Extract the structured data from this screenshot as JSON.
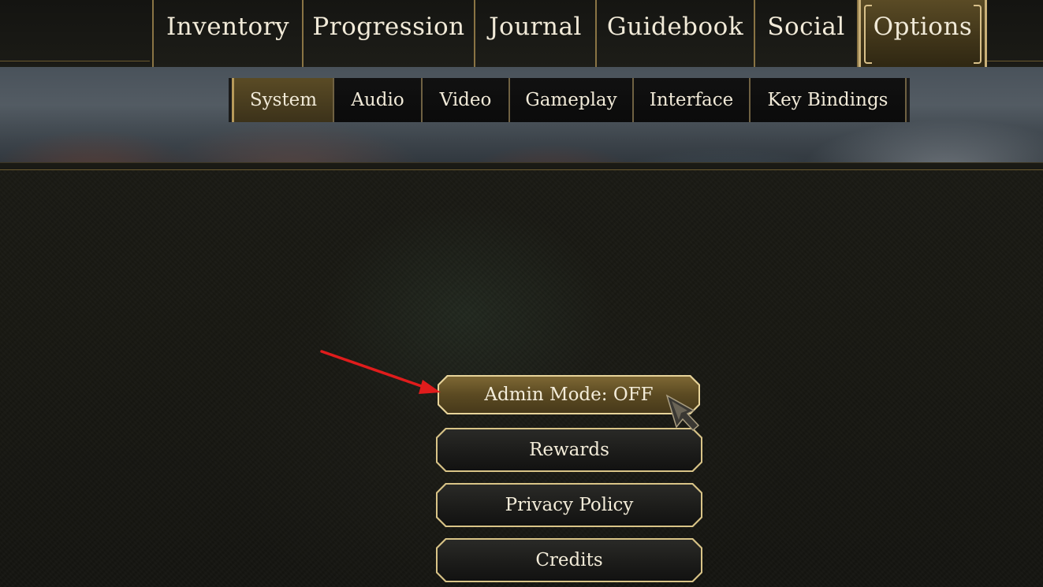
{
  "main_tabs": [
    {
      "label": "Inventory",
      "active": false
    },
    {
      "label": "Progression",
      "active": false
    },
    {
      "label": "Journal",
      "active": false
    },
    {
      "label": "Guidebook",
      "active": false
    },
    {
      "label": "Social",
      "active": false
    },
    {
      "label": "Options",
      "active": true
    }
  ],
  "sub_tabs": [
    {
      "label": "System",
      "active": true
    },
    {
      "label": "Audio",
      "active": false
    },
    {
      "label": "Video",
      "active": false
    },
    {
      "label": "Gameplay",
      "active": false
    },
    {
      "label": "Interface",
      "active": false
    },
    {
      "label": "Key Bindings",
      "active": false
    }
  ],
  "system_menu": {
    "admin_mode": "Admin Mode: OFF",
    "rewards": "Rewards",
    "privacy_policy": "Privacy Policy",
    "credits": "Credits"
  },
  "annotation": {
    "arrow_color": "#e01c1c",
    "arrow_icon": "red-arrow-icon",
    "cursor_icon": "gauntlet-cursor-icon"
  },
  "colors": {
    "gold_accent": "#c9b078",
    "active_tab": "#5a4b25",
    "text": "#f1ead8"
  }
}
